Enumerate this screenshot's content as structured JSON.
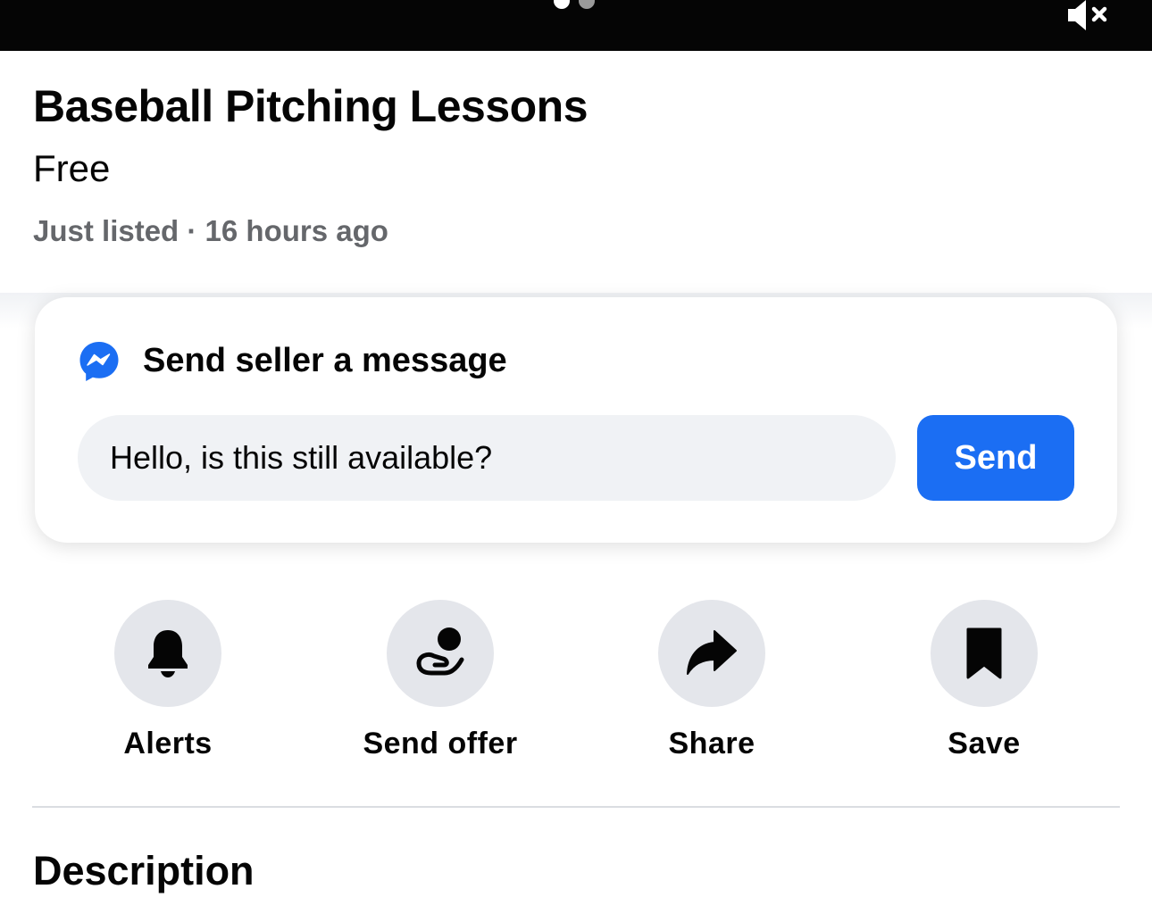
{
  "media": {
    "pager_dots": 2,
    "active_dot": 1,
    "mute_icon": "speaker-muted-icon"
  },
  "listing": {
    "title": "Baseball Pitching Lessons",
    "price": "Free",
    "meta": "Just listed · 16 hours ago"
  },
  "message_card": {
    "icon": "messenger-icon",
    "heading": "Send seller a message",
    "input_value": "Hello, is this still available?",
    "send_label": "Send"
  },
  "actions": [
    {
      "label": "Alerts",
      "icon": "bell-icon"
    },
    {
      "label": "Send offer",
      "icon": "offer-hand-icon"
    },
    {
      "label": "Share",
      "icon": "share-arrow-icon"
    },
    {
      "label": "Save",
      "icon": "bookmark-icon"
    }
  ],
  "description": {
    "heading": "Description"
  },
  "colors": {
    "accent": "#1b6ef3",
    "text_primary": "#050505",
    "text_secondary": "#65676b",
    "input_bg": "#f0f2f5",
    "action_bg": "#e4e6eb"
  }
}
